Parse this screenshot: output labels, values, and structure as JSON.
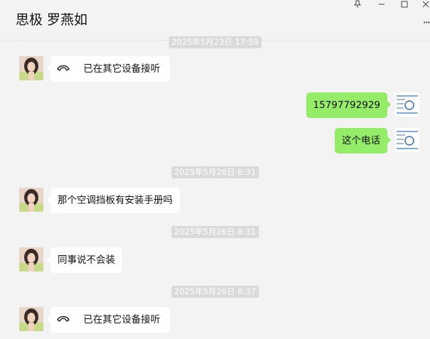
{
  "window": {
    "title": "思极 罗燕如",
    "controls": {
      "pin": "pin-icon",
      "minimize": "minimize-icon",
      "maximize": "maximize-icon",
      "close": "close-icon"
    },
    "more_menu": "···"
  },
  "chat": {
    "messages": [
      {
        "type": "timestamp",
        "text": "2025年5月23日 17:59"
      },
      {
        "type": "call",
        "side": "left",
        "text": "已在其它设备接听"
      },
      {
        "type": "text",
        "side": "right",
        "text": "15797792929"
      },
      {
        "type": "text",
        "side": "right",
        "text": "这个电话"
      },
      {
        "type": "timestamp",
        "text": "2025年5月26日 8:31"
      },
      {
        "type": "text",
        "side": "left",
        "text": "那个空调挡板有安装手册吗"
      },
      {
        "type": "timestamp",
        "text": "2025年5月26日 8:31"
      },
      {
        "type": "text",
        "side": "left",
        "text": "同事说不会装"
      },
      {
        "type": "timestamp",
        "text": "2025年5月26日 8:37"
      },
      {
        "type": "call",
        "side": "left",
        "text": "已在其它设备接听"
      }
    ]
  },
  "colors": {
    "background": "#f3f3f3",
    "bubble_self": "#95ec69",
    "bubble_other": "#ffffff",
    "timestamp_bg": "#dadada"
  }
}
